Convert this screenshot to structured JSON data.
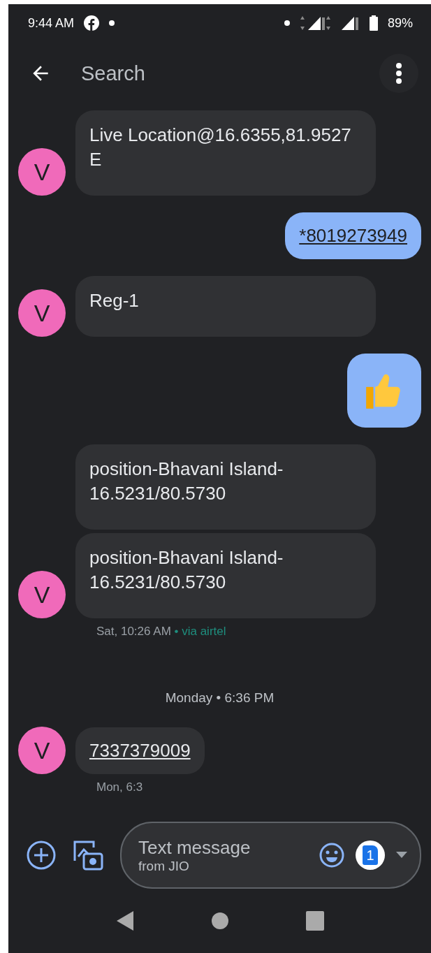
{
  "status_bar": {
    "time": "9:44 AM",
    "battery": "89%"
  },
  "toolbar": {
    "search_placeholder": "Search"
  },
  "messages": [
    {
      "kind": "incoming",
      "avatar": "V",
      "bubbles": [
        {
          "kind": "text",
          "text": "Live Location@16.6355,81.9527 E",
          "link": false
        }
      ]
    },
    {
      "kind": "outgoing",
      "bubbles": [
        {
          "kind": "text",
          "text": "*8019273949",
          "link": true
        }
      ]
    },
    {
      "kind": "incoming",
      "avatar": "V",
      "bubbles": [
        {
          "kind": "text",
          "text": "Reg-1",
          "link": false
        }
      ]
    },
    {
      "kind": "outgoing",
      "bubbles": [
        {
          "kind": "thumbs_up"
        }
      ]
    },
    {
      "kind": "incoming",
      "avatar": "V",
      "bubbles": [
        {
          "kind": "text",
          "text": "position-Bhavani Island-16.5231/80.5730",
          "link": false
        },
        {
          "kind": "text",
          "text": "position-Bhavani Island-16.5231/80.5730",
          "link": false
        }
      ],
      "time": "Sat, 10:26 AM",
      "via": "• via airtel"
    },
    {
      "kind": "divider",
      "text": "Monday • 6:36 PM"
    },
    {
      "kind": "incoming",
      "avatar": "V",
      "bubbles": [
        {
          "kind": "text",
          "text": "7337379009",
          "link": true
        }
      ],
      "time": "Mon, 6:3"
    }
  ],
  "compose": {
    "placeholder": "Text message",
    "sim_label": "from JIO",
    "sim_number": "1"
  }
}
